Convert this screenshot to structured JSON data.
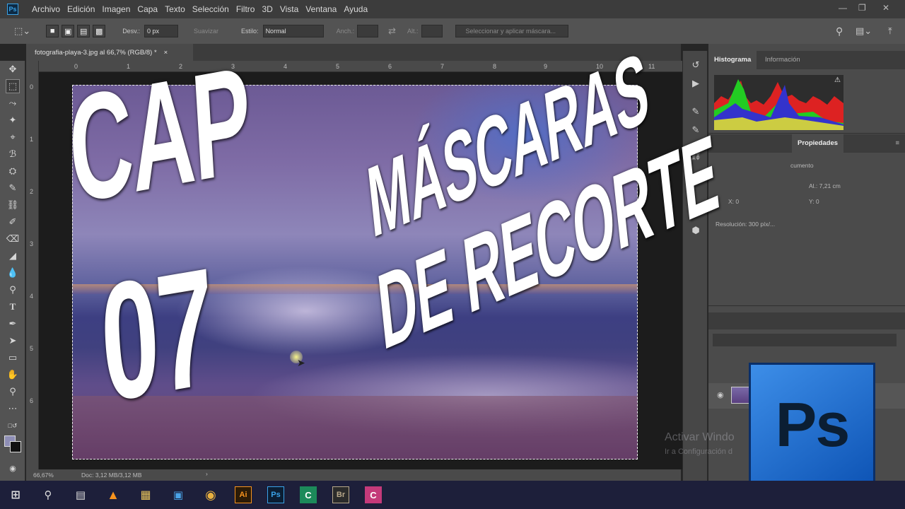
{
  "app": {
    "icon_label": "Ps"
  },
  "menu": [
    "Archivo",
    "Edición",
    "Imagen",
    "Capa",
    "Texto",
    "Selección",
    "Filtro",
    "3D",
    "Vista",
    "Ventana",
    "Ayuda"
  ],
  "options": {
    "desv_label": "Desv.:",
    "desv_value": "0 px",
    "suavizar_label": "Suavizar",
    "estilo_label": "Estilo:",
    "estilo_value": "Normal",
    "anch_label": "Anch.:",
    "alt_label": "Alt.:",
    "mask_button": "Seleccionar y aplicar máscara..."
  },
  "document": {
    "tab_title": "fotografia-playa-3.jpg al 66,7% (RGB/8) *",
    "close": "×"
  },
  "rulers": {
    "top": [
      "0",
      "1",
      "2",
      "3",
      "4",
      "5",
      "6",
      "7",
      "8",
      "9",
      "10",
      "11"
    ],
    "left": [
      "0",
      "1",
      "2",
      "3",
      "4",
      "5",
      "6"
    ]
  },
  "status": {
    "zoom": "66,67%",
    "doc": "Doc: 3,12 MB/3,12 MB"
  },
  "panels": {
    "histogram_tab": "Histograma",
    "info_tab": "Información",
    "properties_tab": "Propiedades",
    "doc_label": "cumento",
    "al_label": "Al.: 7,21 cm",
    "x_label": "X: 0",
    "y_label": "Y: 0",
    "resolution": "Resolución: 300 píx/..."
  },
  "overlay": {
    "cap": "CAP",
    "num": "07",
    "line1": "MÁSCARAS",
    "line2": "DE RECORTE"
  },
  "logo": {
    "text": "Ps"
  },
  "watermark": {
    "line1": "Activar Windo",
    "line2": "Ir a Configuración d"
  },
  "taskbar": {
    "ai": "Ai",
    "ps": "Ps",
    "br": "Br"
  },
  "colors": {
    "ps_blue": "#3d8ee8",
    "taskbar": "#1d1f3a"
  }
}
